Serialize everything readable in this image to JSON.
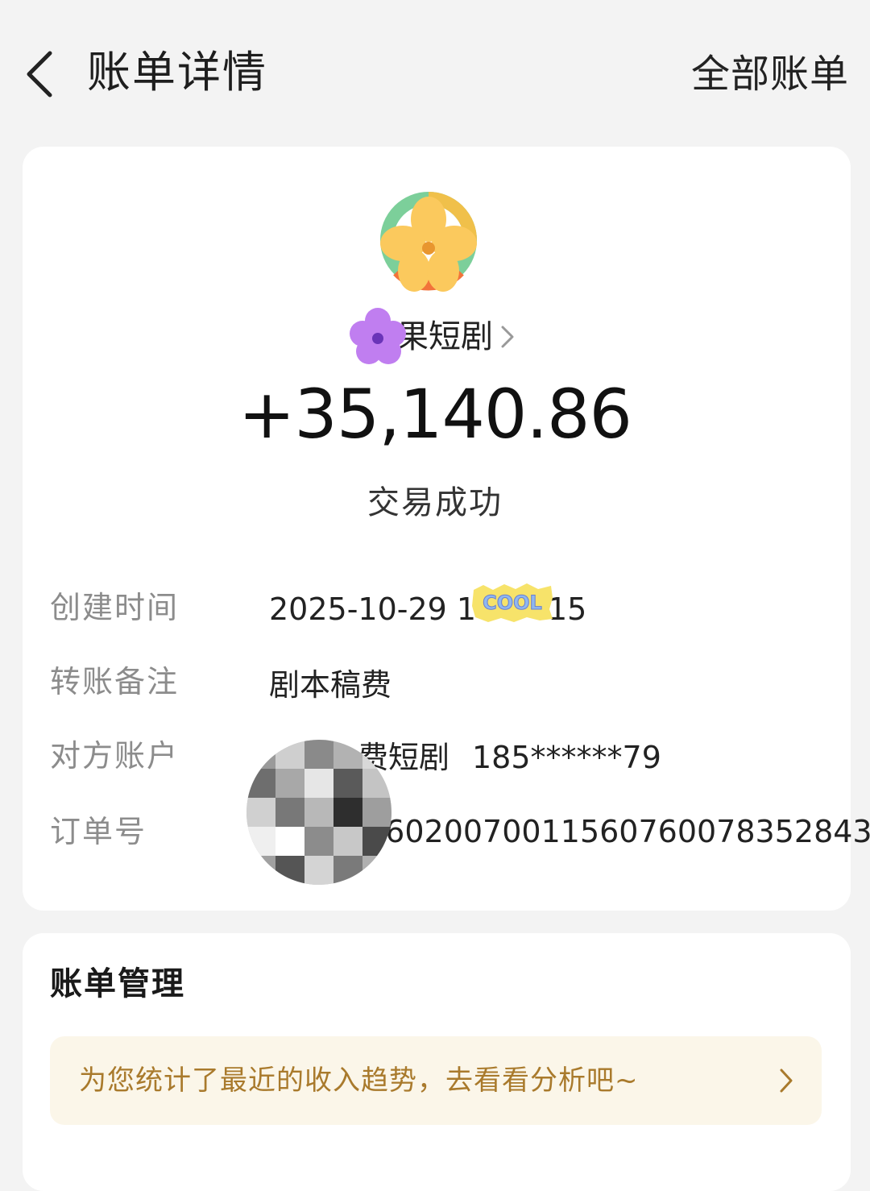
{
  "header": {
    "title": "账单详情",
    "right_action": "全部账单"
  },
  "merchant": {
    "name": "果短剧",
    "logo_icon": "flower-ring-logo",
    "sticker": "purple-flower-sticker"
  },
  "transaction": {
    "amount": "+35,140.86",
    "status": "交易成功"
  },
  "details": [
    {
      "label": "创建时间",
      "value": "2025-10-29 1",
      "value_tail": "15"
    },
    {
      "label": "转账备注",
      "value": "剧本稿费"
    },
    {
      "label": "对方账户",
      "value": "费短剧",
      "value_tail": "185******79"
    },
    {
      "label": "订单号",
      "value": "26020070011560760078352843"
    }
  ],
  "stickers": {
    "cool_text": "COOL"
  },
  "manage": {
    "title": "账单管理",
    "tip": "为您统计了最近的收入趋势，去看看分析吧~"
  },
  "colors": {
    "background": "#f3f3f3",
    "card": "#ffffff",
    "tip_bg": "#fbf6e9",
    "tip_text": "#a97a2c",
    "label_gray": "#8c8c8c"
  }
}
